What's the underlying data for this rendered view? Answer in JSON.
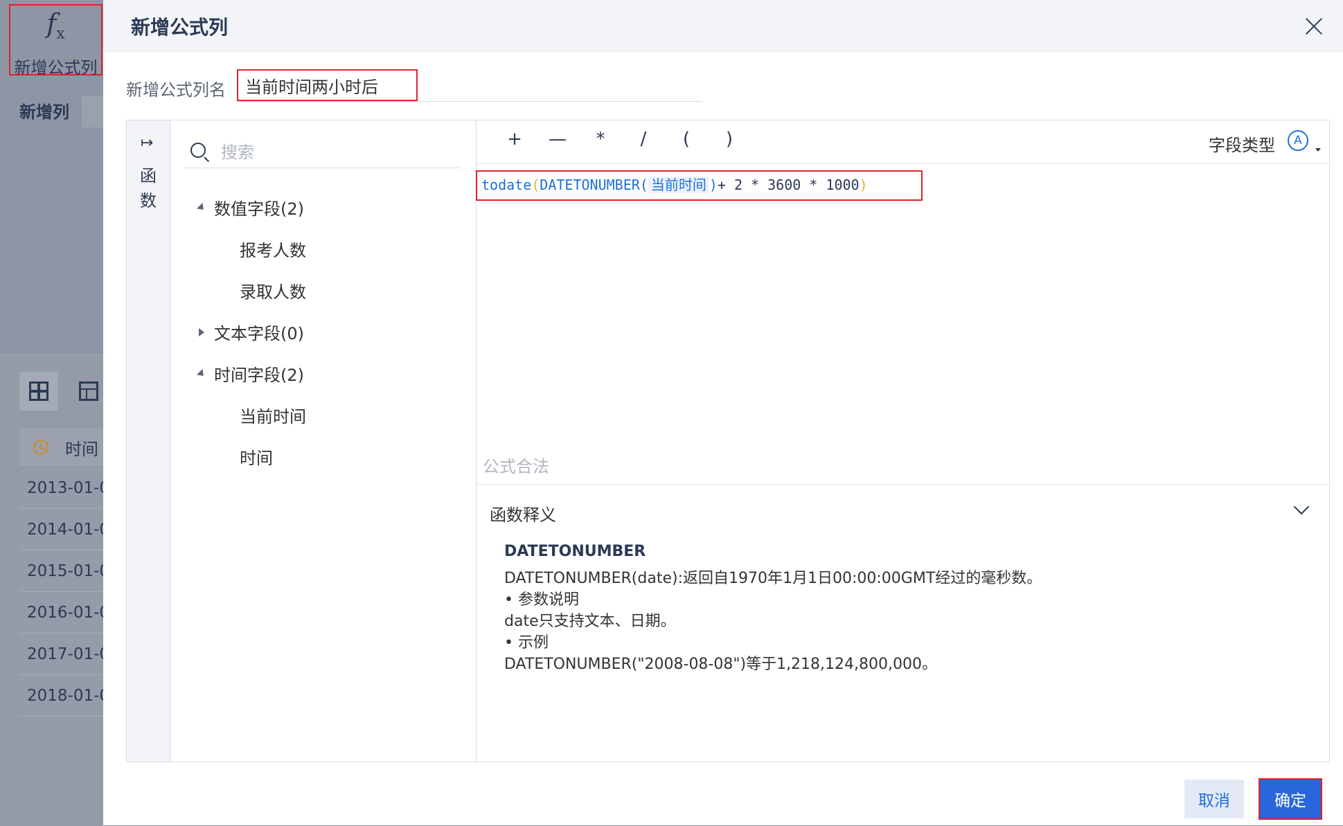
{
  "background": {
    "fx_button": {
      "icon": "fx-icon",
      "label": "新增公式列"
    },
    "add_column_label": "新增列",
    "table": {
      "header": "时间",
      "rows": [
        "2013-01-0",
        "2014-01-0",
        "2015-01-0",
        "2016-01-0",
        "2017-01-0",
        "2018-01-0"
      ]
    }
  },
  "dialog": {
    "title": "新增公式列",
    "name_label": "新增公式列名",
    "name_value": "当前时间两小时后",
    "functions_label": "函数",
    "search": {
      "placeholder": "搜索"
    },
    "tree": {
      "numeric": {
        "label": "数值字段(2)",
        "items": [
          "报考人数",
          "录取人数"
        ]
      },
      "text": {
        "label": "文本字段(0)"
      },
      "time": {
        "label": "时间字段(2)",
        "items": [
          "当前时间",
          "时间"
        ]
      }
    },
    "operators": [
      "+",
      "—",
      "*",
      "/",
      "(",
      ")"
    ],
    "field_type_label": "字段类型",
    "field_type_icon": "A",
    "formula": {
      "func_outer": "todate",
      "func_inner": "DATETONUMBER",
      "field": "当前时间",
      "tail": "+ 2 * 3600 * 1000"
    },
    "validity": "公式合法",
    "explain": {
      "title": "函数释义",
      "fn_name": "DATETONUMBER",
      "lines": [
        "DATETONUMBER(date):返回自1970年1月1日00:00:00GMT经过的毫秒数。",
        "•  参数说明",
        "date只支持文本、日期。",
        "•  示例",
        "DATETONUMBER(\"2008-08-08\")等于1,218,124,800,000。"
      ]
    },
    "cancel_label": "取消",
    "ok_label": "确定"
  },
  "colors": {
    "accent": "#1e6fd9",
    "highlight_border": "#e0222a",
    "primary_button": "#2a66d9"
  }
}
